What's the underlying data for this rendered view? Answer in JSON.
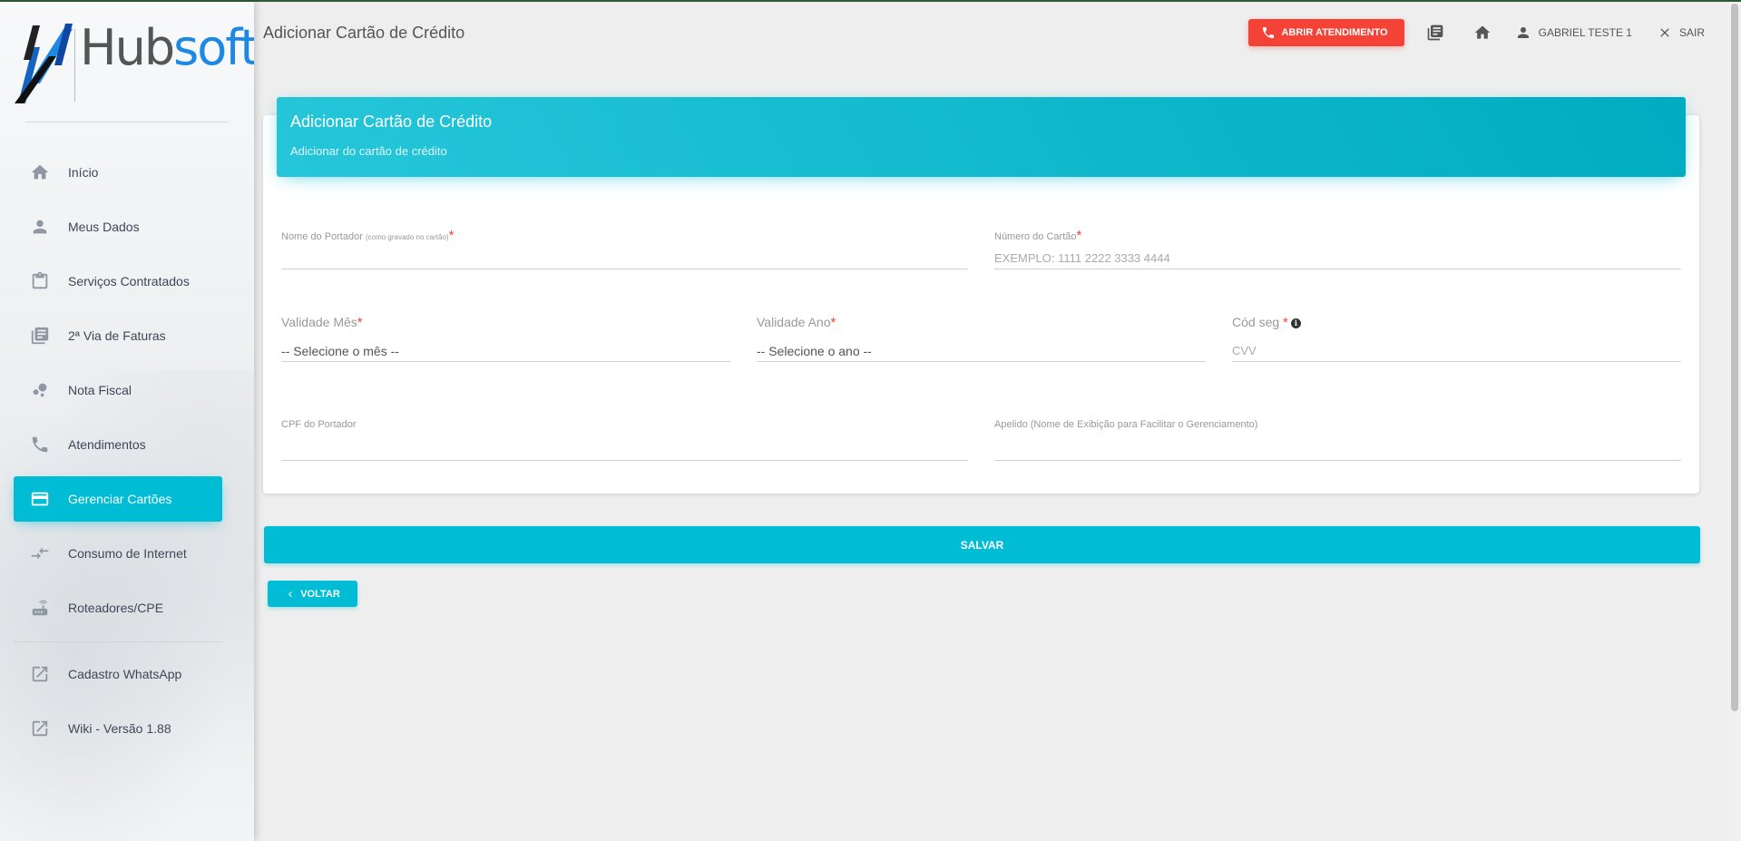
{
  "brand": {
    "logo_text_a": "Hub",
    "logo_text_b": "soft",
    "logo_icon": "hubsoft-h-logo"
  },
  "sidebar": {
    "items": [
      {
        "label": "Início",
        "icon": "home-icon",
        "active": false
      },
      {
        "label": "Meus Dados",
        "icon": "person-icon",
        "active": false
      },
      {
        "label": "Serviços Contratados",
        "icon": "clipboard-icon",
        "active": false
      },
      {
        "label": "2ª Via de Faturas",
        "icon": "library-books-icon",
        "active": false
      },
      {
        "label": "Nota Fiscal",
        "icon": "bubble-chart-icon",
        "active": false
      },
      {
        "label": "Atendimentos",
        "icon": "phone-icon",
        "active": false
      },
      {
        "label": "Gerenciar Cartões",
        "icon": "credit-card-icon",
        "active": true
      },
      {
        "label": "Consumo de Internet",
        "icon": "compare-arrows-icon",
        "active": false
      },
      {
        "label": "Roteadores/CPE",
        "icon": "router-icon",
        "active": false
      }
    ],
    "external": [
      {
        "label": "Cadastro WhatsApp",
        "icon": "open-in-new-icon"
      },
      {
        "label": "Wiki - Versão 1.88",
        "icon": "open-in-new-icon"
      }
    ]
  },
  "header": {
    "page_title": "Adicionar Cartão de Crédito",
    "abrir_atendimento": "ABRIR ATENDIMENTO",
    "user_name": "GABRIEL TESTE 1",
    "exit_label": "SAIR"
  },
  "card": {
    "title": "Adicionar Cartão de Crédito",
    "subtitle": "Adicionar do cartão de crédito"
  },
  "form": {
    "portador_label": "Nome do Portador",
    "portador_hint": "(como gravado no cartão)",
    "portador_value": "",
    "numero_label": "Número do Cartão",
    "numero_placeholder": "EXEMPLO: 1111 2222 3333 4444",
    "mes_label": "Validade Mês",
    "mes_value": "-- Selecione o mês --",
    "ano_label": "Validade Ano",
    "ano_value": "-- Selecione o ano --",
    "cod_label": "Cód seg",
    "cod_placeholder": "CVV",
    "cpf_label": "CPF do Portador",
    "cpf_value": "",
    "apelido_label": "Apelido (Nome de Exibição para Facilitar o Gerenciamento)",
    "apelido_value": "",
    "required_mark": "*"
  },
  "actions": {
    "salvar": "SALVAR",
    "voltar": "VOLTAR"
  },
  "colors": {
    "primary": "#00bcd4",
    "danger": "#f44336",
    "brand_blue": "#1e88e5"
  }
}
